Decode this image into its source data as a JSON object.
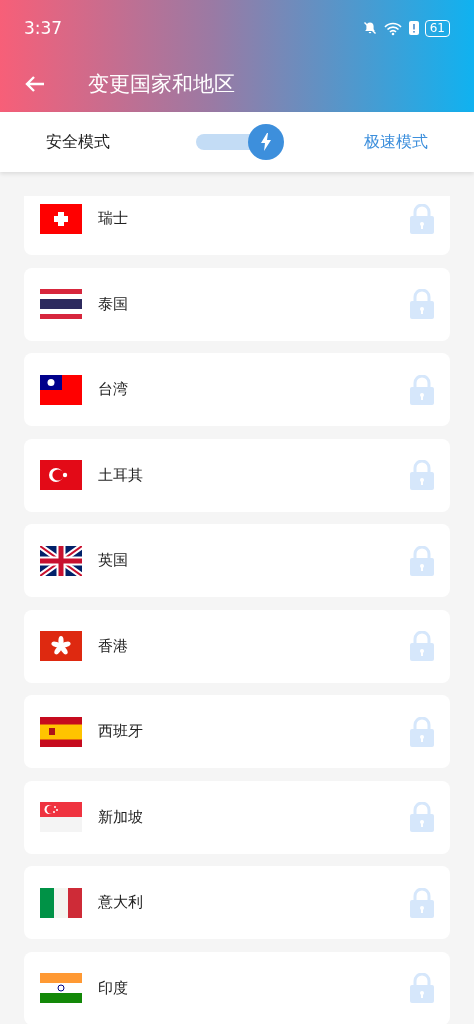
{
  "status_bar": {
    "time": "3:37",
    "battery": "61"
  },
  "header": {
    "title": "变更国家和地区"
  },
  "mode_switch": {
    "left_label": "安全模式",
    "right_label": "极速模式",
    "on": true
  },
  "countries": [
    {
      "name": "瑞士",
      "kind": "ch",
      "locked": true
    },
    {
      "name": "泰国",
      "kind": "th",
      "locked": true
    },
    {
      "name": "台湾",
      "kind": "tw",
      "locked": true
    },
    {
      "name": "土耳其",
      "kind": "tr",
      "locked": true
    },
    {
      "name": "英国",
      "kind": "gb",
      "locked": true
    },
    {
      "name": "香港",
      "kind": "hk",
      "locked": true
    },
    {
      "name": "西班牙",
      "kind": "es",
      "locked": true
    },
    {
      "name": "新加坡",
      "kind": "sg",
      "locked": true
    },
    {
      "name": "意大利",
      "kind": "it",
      "locked": true
    },
    {
      "name": "印度",
      "kind": "in",
      "locked": true
    }
  ]
}
